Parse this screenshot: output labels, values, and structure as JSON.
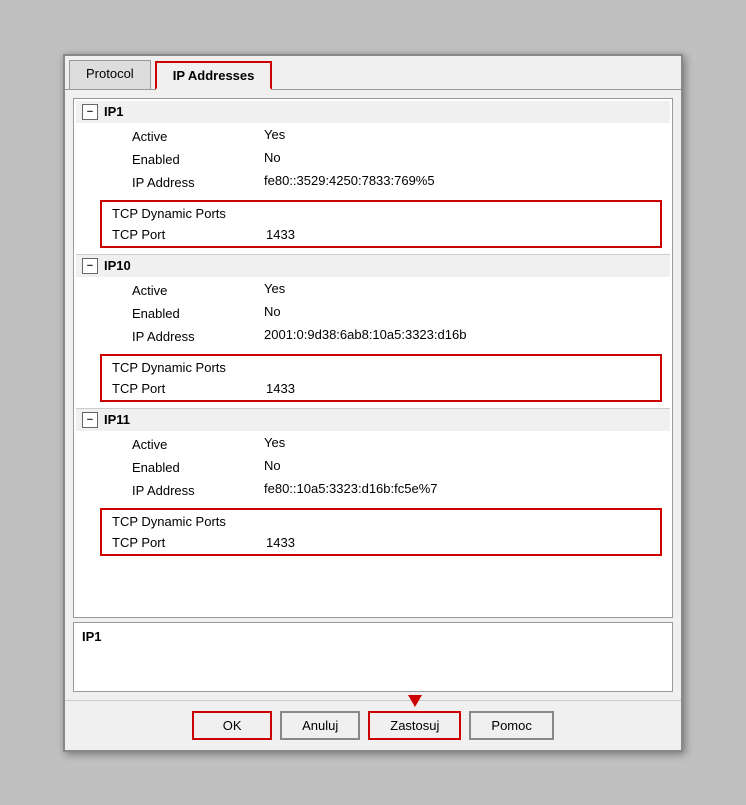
{
  "tabs": [
    {
      "label": "Protocol",
      "active": false
    },
    {
      "label": "IP Addresses",
      "active": true
    }
  ],
  "sections": [
    {
      "id": "IP1",
      "label": "IP1",
      "collapsed": false,
      "properties": [
        {
          "name": "Active",
          "value": "Yes"
        },
        {
          "name": "Enabled",
          "value": "No"
        },
        {
          "name": "IP Address",
          "value": "fe80::3529:4250:7833:769%5"
        }
      ],
      "subSection": {
        "rows": [
          {
            "name": "TCP Dynamic Ports",
            "value": ""
          },
          {
            "name": "TCP Port",
            "value": "1433"
          }
        ]
      }
    },
    {
      "id": "IP10",
      "label": "IP10",
      "collapsed": false,
      "properties": [
        {
          "name": "Active",
          "value": "Yes"
        },
        {
          "name": "Enabled",
          "value": "No"
        },
        {
          "name": "IP Address",
          "value": "2001:0:9d38:6ab8:10a5:3323:d16b"
        }
      ],
      "subSection": {
        "rows": [
          {
            "name": "TCP Dynamic Ports",
            "value": ""
          },
          {
            "name": "TCP Port",
            "value": "1433"
          }
        ]
      }
    },
    {
      "id": "IP11",
      "label": "IP11",
      "collapsed": false,
      "properties": [
        {
          "name": "Active",
          "value": "Yes"
        },
        {
          "name": "Enabled",
          "value": "No"
        },
        {
          "name": "IP Address",
          "value": "fe80::10a5:3323:d16b:fc5e%7"
        }
      ],
      "subSection": {
        "rows": [
          {
            "name": "TCP Dynamic Ports",
            "value": ""
          },
          {
            "name": "TCP Port",
            "value": "1433"
          }
        ]
      }
    }
  ],
  "statusBar": {
    "text": "IP1"
  },
  "buttons": [
    {
      "label": "OK",
      "outlined": true
    },
    {
      "label": "Anuluj",
      "outlined": false
    },
    {
      "label": "Zastosuj",
      "outlined": true,
      "primary": true,
      "hasArrow": true
    },
    {
      "label": "Pomoc",
      "outlined": false
    }
  ],
  "icons": {
    "collapse": "−",
    "scrollUp": "▲",
    "scrollDown": "▼"
  }
}
